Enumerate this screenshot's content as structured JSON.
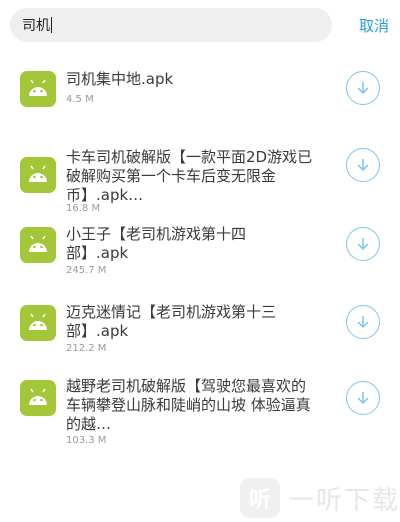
{
  "search": {
    "value": "司机",
    "cancel_label": "取消"
  },
  "results": [
    {
      "title": "司机集中地.apk",
      "size": "4.5 M"
    },
    {
      "title": "卡车司机破解版【一款平面2D游戏已破解购买第一个卡车后变无限金币】.apk…",
      "size": "16.8 M"
    },
    {
      "title": "小王子【老司机游戏第十四部】.apk",
      "size": "245.7 M"
    },
    {
      "title": "迈克迷情记【老司机游戏第十三部】.apk",
      "size": "212.2 M"
    },
    {
      "title": "越野老司机破解版【驾驶您最喜欢的车辆攀登山脉和陡峭的山坡 体验逼真的越…",
      "size": "103.3 M"
    }
  ],
  "watermark": {
    "glyph": "听",
    "text": "一听下载"
  },
  "colors": {
    "accent": "#2a9be0",
    "android_green": "#a4c639",
    "download_ring": "#7ec4ef"
  },
  "icons": {
    "app": "android-icon",
    "download": "download-arrow-icon"
  }
}
